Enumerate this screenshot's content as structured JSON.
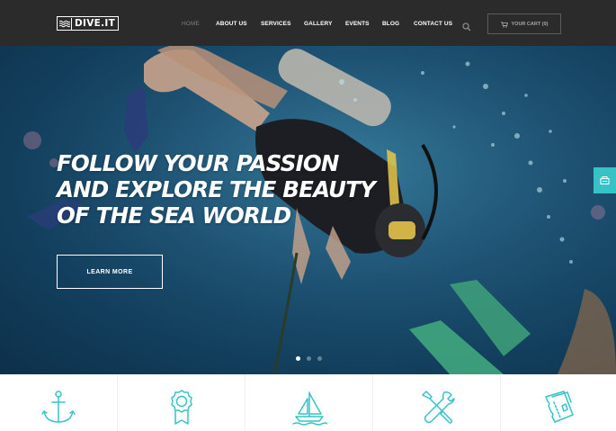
{
  "brand": {
    "name": "DIVE.IT"
  },
  "nav": {
    "items": [
      {
        "label": "HOME",
        "active": true
      },
      {
        "label": "ABOUT US"
      },
      {
        "label": "SERVICES"
      },
      {
        "label": "GALLERY"
      },
      {
        "label": "EVENTS"
      },
      {
        "label": "BLOG"
      },
      {
        "label": "CONTACT US"
      }
    ],
    "search_icon": "search-icon",
    "cart_label": "YOUR CART (0)",
    "cart_icon": "cart-icon"
  },
  "hero": {
    "headline": [
      "FOLLOW YOUR PASSION",
      "AND EXPLORE THE BEAUTY",
      "OF THE SEA WORLD"
    ],
    "cta_label": "LEARN MORE",
    "slides_total": 3,
    "slide_active": 1,
    "side_tab_icon": "bag-icon"
  },
  "features": {
    "icons": [
      "anchor-icon",
      "award-ribbon-icon",
      "sailboat-icon",
      "tools-icon",
      "tickets-icon"
    ]
  },
  "colors": {
    "nav_bg": "#2b2b2c",
    "accent_teal": "#36c3c6",
    "text_light": "#ffffff",
    "nav_muted": "#7d7d7d"
  }
}
